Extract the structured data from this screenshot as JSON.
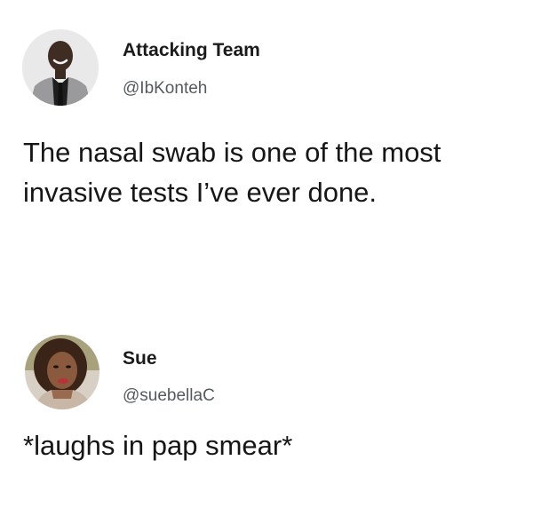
{
  "tweets": [
    {
      "display_name": "Attacking Team",
      "handle": "@IbKonteh",
      "text_lines": [
        "The nasal swab is one of the most",
        "invasive tests I’ve ever done."
      ],
      "avatar_icon": "profile-photo-man-in-suit"
    },
    {
      "display_name": "Sue",
      "handle": "@suebellaC",
      "text_lines": [
        "*laughs in pap smear*"
      ],
      "avatar_icon": "profile-photo-woman"
    }
  ]
}
